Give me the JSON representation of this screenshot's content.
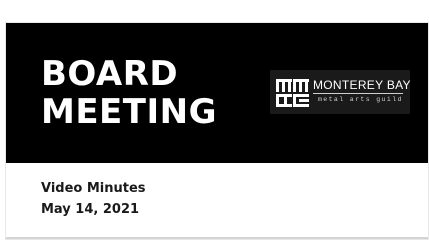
{
  "banner": {
    "title_line1": "BOARD",
    "title_line2": "MEETING",
    "background": "#000000",
    "text_color": "#ffffff"
  },
  "logo": {
    "name": "MONTEREY BAY",
    "tagline": "metal arts guild",
    "mark_icon": "mbmag-monogram-icon"
  },
  "details": {
    "type": "Video Minutes",
    "date": "May 14, 2021"
  }
}
